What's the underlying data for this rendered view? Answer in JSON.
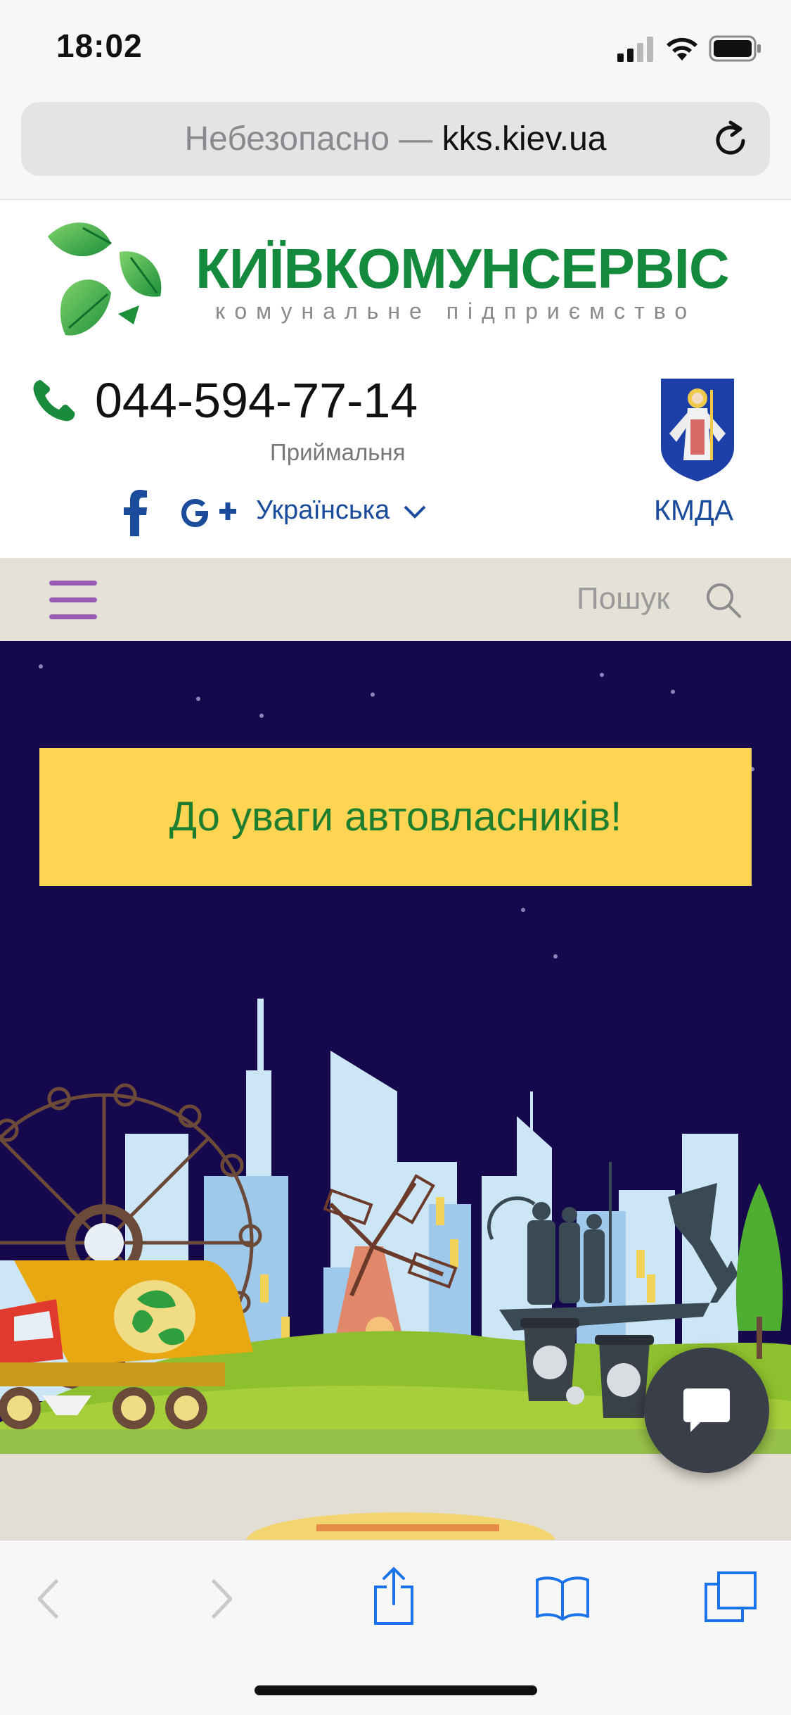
{
  "status_bar": {
    "time": "18:02"
  },
  "browser": {
    "url_prefix": "Небезопасно — ",
    "url_host": "kks.kiev.ua"
  },
  "header": {
    "brand_name": "КИЇВКОМУНСЕРВІС",
    "brand_subtitle": "комунальне підприємство",
    "phone": "044-594-77-14",
    "phone_label": "Приймальня",
    "language": "Українська",
    "kmda_label": "КМДА"
  },
  "nav": {
    "search_placeholder": "Пошук"
  },
  "hero": {
    "banner_text": "До уваги автовласників!"
  },
  "colors": {
    "brand_green": "#148a3d",
    "link_blue": "#1b4b9b",
    "hero_bg": "#16084d",
    "banner_yellow": "#fdd552",
    "nav_bg": "#e5e1d6",
    "menu_purple": "#9b59b6"
  },
  "icons": [
    "signal-icon",
    "wifi-icon",
    "battery-icon",
    "reload-icon",
    "recycle-logo-icon",
    "phone-icon",
    "facebook-icon",
    "google-plus-icon",
    "chevron-down-icon",
    "kyiv-coat-of-arms-icon",
    "hamburger-menu-icon",
    "search-icon",
    "chat-icon",
    "back-icon",
    "forward-icon",
    "share-icon",
    "bookmarks-icon",
    "tabs-icon"
  ]
}
